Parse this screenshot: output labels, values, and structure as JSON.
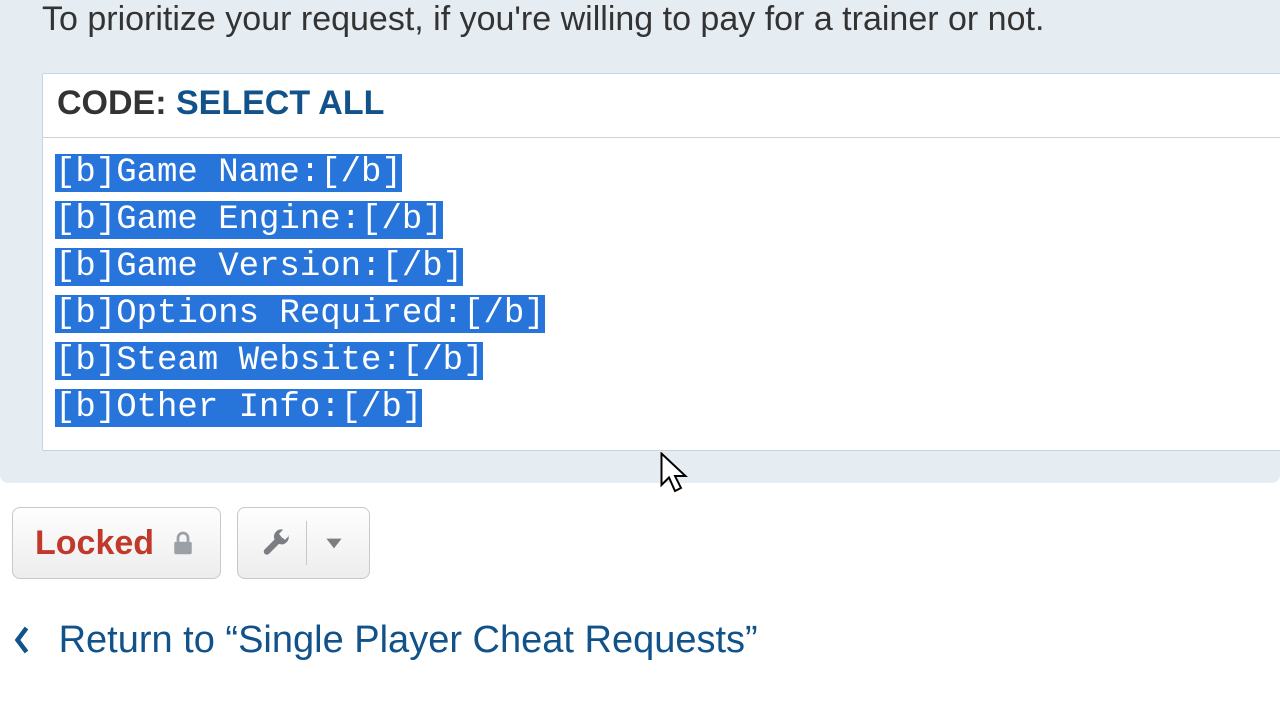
{
  "post": {
    "prompt_text": "To prioritize your request, if you're willing to pay for a trainer or not."
  },
  "codebox": {
    "label": "CODE: ",
    "select_all": "SELECT ALL",
    "lines": [
      "[b]Game Name:[/b]",
      "[b]Game Engine:[/b]",
      "[b]Game Version:[/b]",
      "[b]Options Required:[/b]",
      "[b]Steam Website:[/b]",
      "[b]Other Info:[/b]"
    ],
    "selection_highlight": true
  },
  "actions": {
    "locked_label": "Locked"
  },
  "return_link": {
    "text": "Return to “Single Player Cheat Requests”"
  }
}
